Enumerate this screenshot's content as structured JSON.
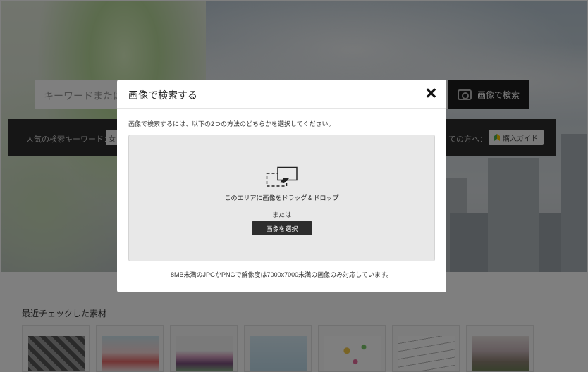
{
  "background": {
    "search_placeholder": "キーワードまたは",
    "image_search_button": "画像で検索",
    "camera_icon": "camera-icon",
    "keyword_label": "人気の検索キーワード：",
    "keyword_tag": "女",
    "beginner_text": "ての方へ：",
    "guide_button": "購入ガイド",
    "recent_title": "最近チェックした素材"
  },
  "modal": {
    "title": "画像で検索する",
    "close_icon": "close-icon",
    "description": "画像で検索するには、以下の2つの方法のどちらかを選択してください。",
    "drop_text": "このエリアに画像をドラッグ＆ドロップ",
    "or_text": "または",
    "select_button": "画像を選択",
    "note": "8MB未満のJPGかPNGで解像度は7000x7000未満の画像のみ対応しています。"
  },
  "colors": {
    "overlay": "#000000",
    "button_dark": "#2d2d2d",
    "drop_zone_bg": "#e8e8e8"
  }
}
